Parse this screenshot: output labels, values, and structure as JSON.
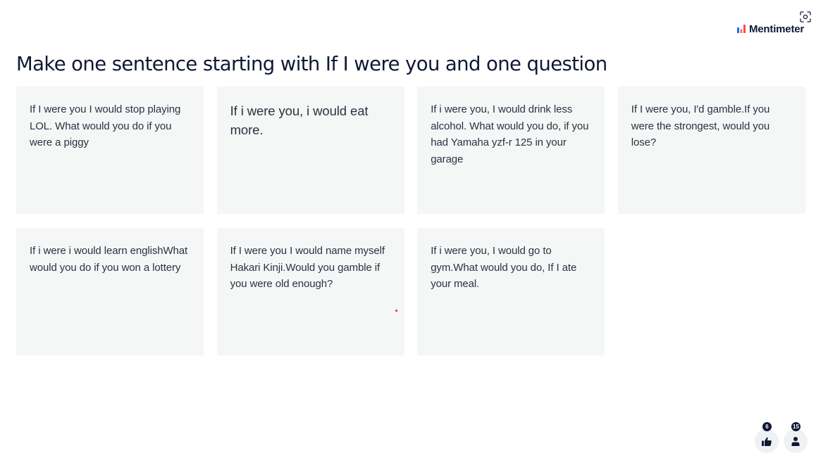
{
  "header": {
    "brand_name": "Mentimeter",
    "brand_colors": [
      "#196cff",
      "#ff7a3d",
      "#ff4b4b"
    ],
    "fullscreen_icon": "fullscreen-icon"
  },
  "question": {
    "title": "Make one sentence starting with If I were you and one question"
  },
  "responses": [
    {
      "text": "If I were you I would stop playing LOL. What would you do if you were a piggy"
    },
    {
      "text": "If i were you, i would eat more."
    },
    {
      "text": "If i were you, I would drink less alcohol. What would you do, if you had Yamaha yzf-r 125 in your garage"
    },
    {
      "text": "If I were you, I'd gamble.If you were the strongest, would you lose?"
    },
    {
      "text": "If i were i would learn englishWhat would you do if you won a lottery"
    },
    {
      "text": "If I were you I would name myself Hakari Kinji.Would you gamble if you were old enough?"
    },
    {
      "text": "If i were you, I would go to gym.What would you do, If I ate your meal."
    }
  ],
  "footer": {
    "likes": {
      "count": "6",
      "icon": "thumbs-up-icon"
    },
    "participants": {
      "count": "15",
      "icon": "person-icon"
    }
  },
  "colors": {
    "card_background": "#f5f6f6",
    "text": "#101834",
    "badge": "#101834"
  }
}
